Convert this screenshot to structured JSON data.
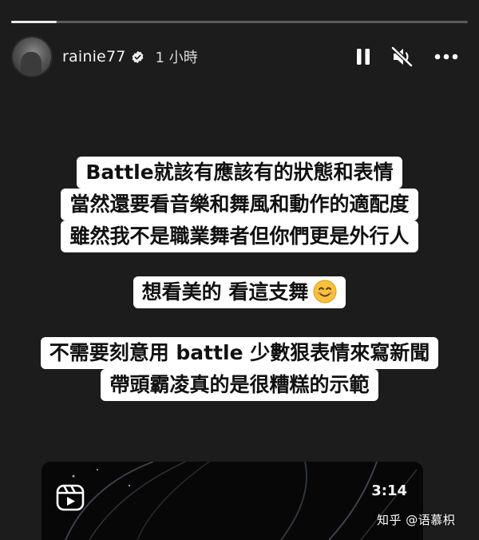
{
  "story": {
    "progress": 0.1,
    "username": "rainie77",
    "time": "1 小時",
    "icons": {
      "verified": "verified-badge-icon",
      "pause": "pause-icon",
      "mute": "speaker-muted-icon",
      "more": "more-options-icon"
    }
  },
  "text_blocks": {
    "block1": [
      "Battle就該有應該有的狀態和表情",
      "當然還要看音樂和舞風和動作的適配度",
      "雖然我不是職業舞者但你們更是外行人"
    ],
    "block2": "想看美的 看這支舞",
    "block3": [
      "不需要刻意用 battle 少數狠表情來寫新聞",
      "帶頭霸凌真的是很糟糕的示範"
    ]
  },
  "video": {
    "duration": "3:14",
    "icon": "reels-icon"
  },
  "watermark": "知乎 @语慕枳",
  "colors": {
    "background": "#1c1c1c",
    "bubble": "#ffffff",
    "text": "#111111"
  }
}
